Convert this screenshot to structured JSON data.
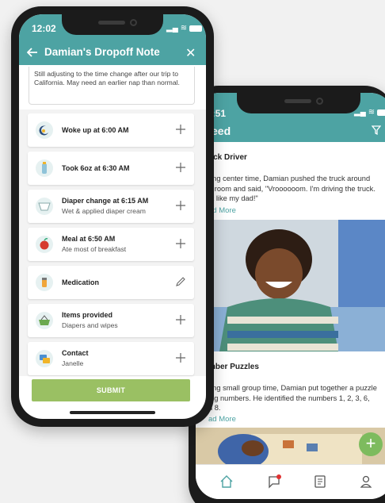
{
  "back_phone": {
    "status_time": "2:51",
    "header_title": "eed",
    "posts": [
      {
        "title": "uck Driver",
        "body_lines": [
          "ring center time, Damian pushed the truck around",
          "e room and said, \"Vroooooom. I'm driving the truck.",
          "st like my dad!\""
        ],
        "read_more": "ad More"
      },
      {
        "title": "mber Puzzles",
        "body_lines": [
          "ring small group time, Damian put together a puzzle",
          "ing numbers. He identified the numbers 1, 2, 3, 6,",
          "d 8."
        ],
        "read_more": "ad More"
      }
    ],
    "fab_label": "+",
    "tabs": [
      "home-icon",
      "chat-icon",
      "report-icon",
      "profile-icon"
    ]
  },
  "front_phone": {
    "status_time": "12:02",
    "header_title": "Damian's Dropoff Note",
    "close_label": "✕",
    "notes_text": "Still adjusting to the time change after our trip to California. May need an earlier nap than normal.",
    "items": [
      {
        "title": "Woke up at 6:00 AM",
        "subtitle": "",
        "icon": "moon-icon",
        "action": "plus-icon"
      },
      {
        "title": "Took 6oz at 6:30 AM",
        "subtitle": "",
        "icon": "bottle-icon",
        "action": "plus-icon"
      },
      {
        "title": "Diaper change at 6:15 AM",
        "subtitle": "Wet & applied diaper cream",
        "icon": "diaper-icon",
        "action": "plus-icon"
      },
      {
        "title": "Meal at 6:50 AM",
        "subtitle": "Ate most of breakfast",
        "icon": "apple-icon",
        "action": "plus-icon"
      },
      {
        "title": "Medication",
        "subtitle": "",
        "icon": "medication-icon",
        "action": "pencil-icon"
      },
      {
        "title": "Items provided",
        "subtitle": "Diapers and wipes",
        "icon": "basket-icon",
        "action": "plus-icon"
      },
      {
        "title": "Contact",
        "subtitle": "Janelle",
        "icon": "contact-icon",
        "action": "plus-icon"
      }
    ],
    "submit_label": "SUBMIT"
  },
  "colors": {
    "teal": "#4da3a3",
    "submit_green": "#9ac063",
    "fab_green": "#7dbb5e"
  }
}
